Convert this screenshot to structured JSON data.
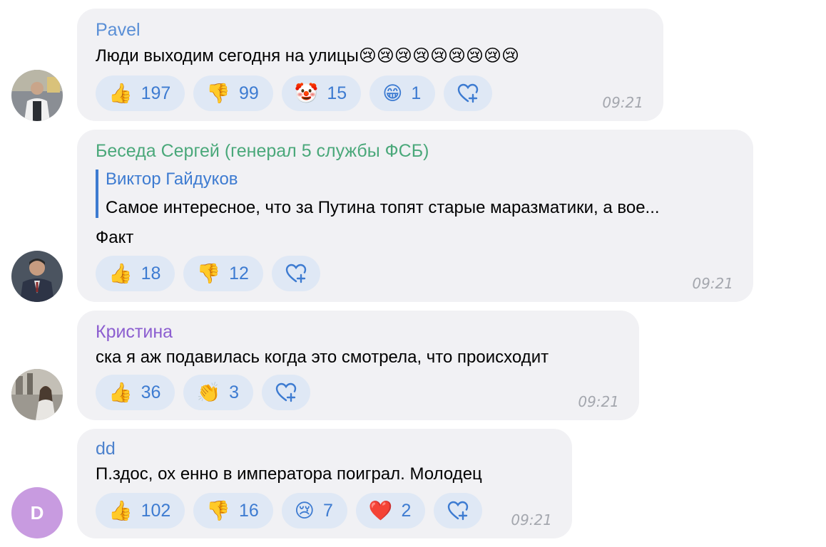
{
  "messages": [
    {
      "author": "Pavel",
      "author_color": "#5a8fd6",
      "text": "Люди выходим сегодня на улицы😢😢😢😢😢😢😢😢😢",
      "reactions": [
        {
          "emoji": "👍",
          "count": "197"
        },
        {
          "emoji": "👎",
          "count": "99"
        },
        {
          "emoji": "🤡",
          "count": "15"
        },
        {
          "emoji": "😁",
          "count": "1"
        }
      ],
      "time": "09:21"
    },
    {
      "author": "Беседа Сергей (генерал 5 службы ФСБ)",
      "author_color": "#4aa87a",
      "reply": {
        "author": "Виктор Гайдуков",
        "text": "Самое интересное, что за Путина топят старые маразматики, а вое..."
      },
      "text": "Факт",
      "reactions": [
        {
          "emoji": "👍",
          "count": "18"
        },
        {
          "emoji": "👎",
          "count": "12"
        }
      ],
      "time": "09:21"
    },
    {
      "author": "Кристина",
      "author_color": "#8c5ed0",
      "text": "ска я аж подавилась когда это смотрела, что происходит",
      "reactions": [
        {
          "emoji": "👍",
          "count": "36"
        },
        {
          "emoji": "👏",
          "count": "3"
        }
      ],
      "time": "09:21"
    },
    {
      "author": "dd",
      "author_color": "#4d82cd",
      "avatar_letter": "D",
      "text": "П.здос, ох енно в императора поиграл. Молодец",
      "reactions": [
        {
          "emoji": "👍",
          "count": "102"
        },
        {
          "emoji": "👎",
          "count": "16"
        },
        {
          "emoji": "😢",
          "count": "7"
        },
        {
          "emoji": "❤️",
          "count": "2"
        }
      ],
      "time": "09:21"
    }
  ],
  "icons": {
    "add_reaction": "heart-plus-icon"
  }
}
